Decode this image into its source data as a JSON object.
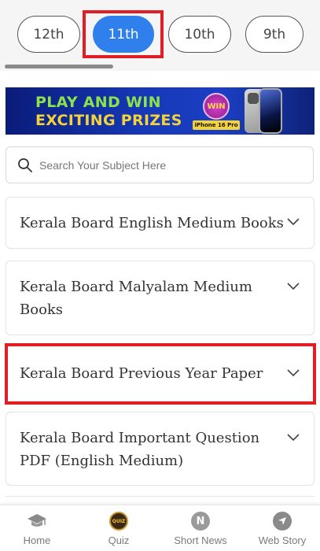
{
  "class_tabs": [
    {
      "label": "12th",
      "active": false
    },
    {
      "label": "11th",
      "active": true
    },
    {
      "label": "10th",
      "active": false
    },
    {
      "label": "9th",
      "active": false
    }
  ],
  "banner": {
    "line1": "PLAY AND WIN",
    "line2": "EXCITING PRIZES",
    "badge": "WIN",
    "product_tag": "iPhone 16 Pro"
  },
  "search": {
    "placeholder": "Search Your Subject Here",
    "value": ""
  },
  "sections": [
    {
      "label": "Kerala Board English Medium Books"
    },
    {
      "label": "Kerala Board Malyalam Medium Books"
    },
    {
      "label": "Kerala Board Previous Year Paper",
      "highlighted": true
    },
    {
      "label": "Kerala Board Important Question PDF (English Medium)"
    }
  ],
  "bottom_nav": [
    {
      "label": "Home",
      "icon": "graduation-cap-icon"
    },
    {
      "label": "Quiz",
      "icon": "quiz-icon"
    },
    {
      "label": "Short News",
      "icon": "news-icon"
    },
    {
      "label": "Web Story",
      "icon": "navigation-arrow-icon"
    }
  ],
  "colors": {
    "active_tab": "#2f80ed",
    "highlight": "#e01e26"
  }
}
